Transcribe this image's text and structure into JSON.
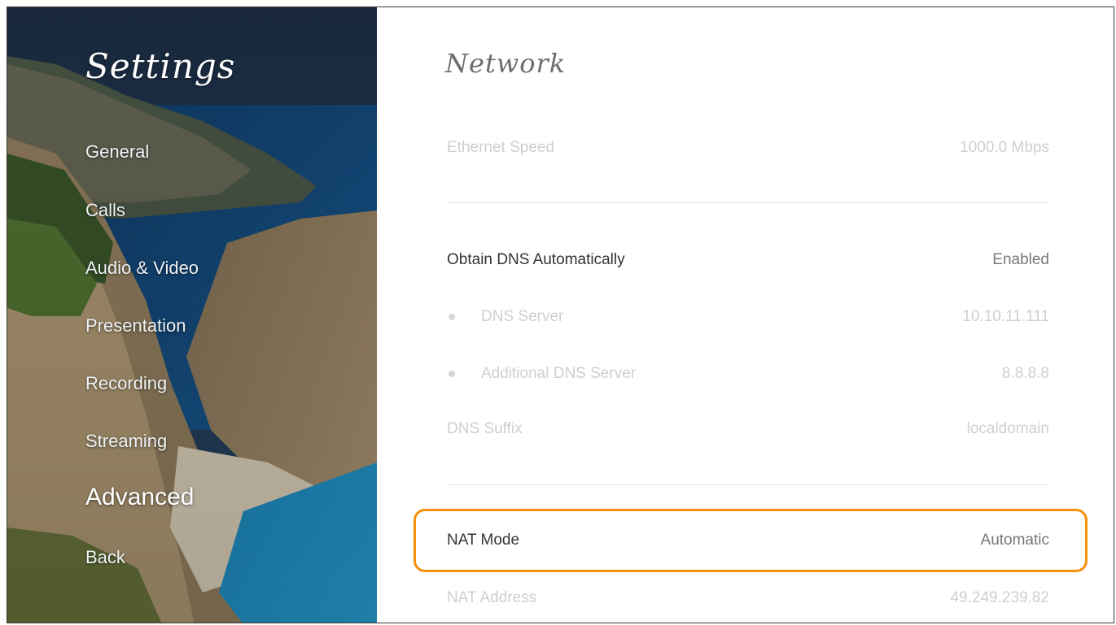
{
  "sidebar": {
    "title": "Settings",
    "items": [
      {
        "label": "General"
      },
      {
        "label": "Calls"
      },
      {
        "label": "Audio & Video"
      },
      {
        "label": "Presentation"
      },
      {
        "label": "Recording"
      },
      {
        "label": "Streaming"
      },
      {
        "label": "Advanced",
        "active": true
      },
      {
        "label": "Back"
      }
    ]
  },
  "main": {
    "title": "Network",
    "rows": [
      {
        "label": "Ethernet Speed",
        "value": "1000.0 Mbps"
      },
      {
        "label": "Obtain DNS Automatically",
        "value": "Enabled"
      },
      {
        "label": "DNS Server",
        "value": "10.10.11.111"
      },
      {
        "label": "Additional DNS Server",
        "value": "8.8.8.8"
      },
      {
        "label": "DNS Suffix",
        "value": "localdomain"
      },
      {
        "label": "NAT Mode",
        "value": "Automatic",
        "focused": true
      },
      {
        "label": "NAT Address",
        "value": "49.249.239.82"
      }
    ]
  },
  "colors": {
    "focus_outline": "#f7900a",
    "muted_text": "#cfcfcf",
    "primary_text": "#333333",
    "secondary_text": "#777777"
  }
}
